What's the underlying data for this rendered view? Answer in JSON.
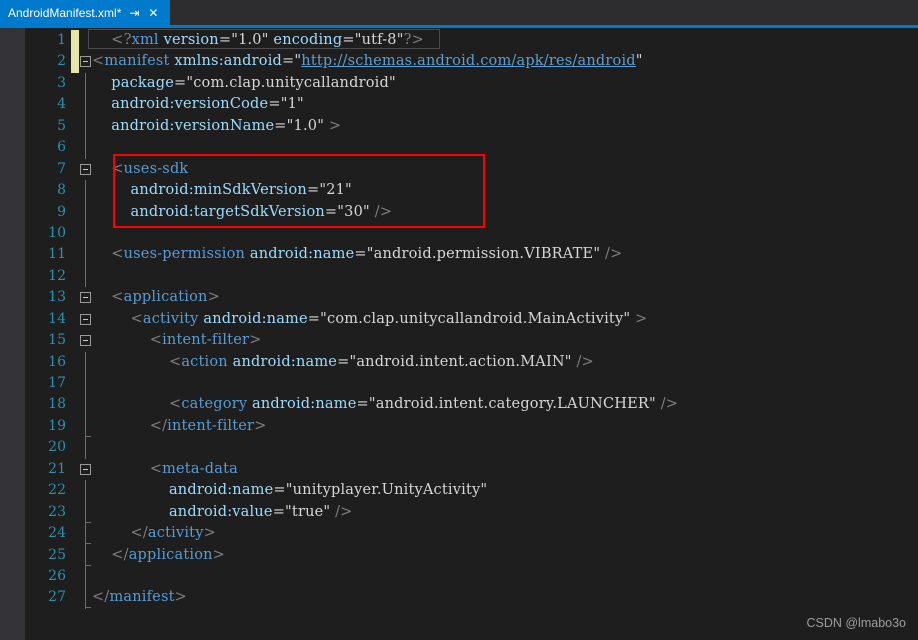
{
  "tab": {
    "title": "AndroidManifest.xml*",
    "pin_icon": "pin-icon",
    "close_icon": "close-icon",
    "pin_glyph": "⇥",
    "close_glyph": "✕"
  },
  "editor": {
    "language": "xml",
    "accent_color": "#007acc",
    "background": "#1e1e1e",
    "gutter_color": "#2b91af",
    "annotation_color": "#ff0000",
    "total_lines": 27,
    "lines": [
      {
        "n": 1,
        "changed": true,
        "fold": "none",
        "text": "    <?xml version=\"1.0\" encoding=\"utf-8\"?>"
      },
      {
        "n": 2,
        "changed": true,
        "fold": "open",
        "text": "<manifest xmlns:android=\"http://schemas.android.com/apk/res/android\""
      },
      {
        "n": 3,
        "changed": false,
        "fold": "line",
        "text": "    package=\"com.clap.unitycallandroid\""
      },
      {
        "n": 4,
        "changed": false,
        "fold": "line",
        "text": "    android:versionCode=\"1\""
      },
      {
        "n": 5,
        "changed": false,
        "fold": "line",
        "text": "    android:versionName=\"1.0\" >"
      },
      {
        "n": 6,
        "changed": false,
        "fold": "line",
        "text": ""
      },
      {
        "n": 7,
        "changed": false,
        "fold": "open",
        "text": "    <uses-sdk"
      },
      {
        "n": 8,
        "changed": false,
        "fold": "line",
        "text": "        android:minSdkVersion=\"21\""
      },
      {
        "n": 9,
        "changed": false,
        "fold": "line",
        "text": "        android:targetSdkVersion=\"30\" />"
      },
      {
        "n": 10,
        "changed": false,
        "fold": "line",
        "text": ""
      },
      {
        "n": 11,
        "changed": false,
        "fold": "line",
        "text": "    <uses-permission android:name=\"android.permission.VIBRATE\" />"
      },
      {
        "n": 12,
        "changed": false,
        "fold": "line",
        "text": ""
      },
      {
        "n": 13,
        "changed": false,
        "fold": "open",
        "text": "    <application>"
      },
      {
        "n": 14,
        "changed": false,
        "fold": "open",
        "text": "        <activity android:name=\"com.clap.unitycallandroid.MainActivity\" >"
      },
      {
        "n": 15,
        "changed": false,
        "fold": "open",
        "text": "            <intent-filter>"
      },
      {
        "n": 16,
        "changed": false,
        "fold": "line",
        "text": "                <action android:name=\"android.intent.action.MAIN\" />"
      },
      {
        "n": 17,
        "changed": false,
        "fold": "line",
        "text": ""
      },
      {
        "n": 18,
        "changed": false,
        "fold": "line",
        "text": "                <category android:name=\"android.intent.category.LAUNCHER\" />"
      },
      {
        "n": 19,
        "changed": false,
        "fold": "end",
        "text": "            </intent-filter>"
      },
      {
        "n": 20,
        "changed": false,
        "fold": "line",
        "text": ""
      },
      {
        "n": 21,
        "changed": false,
        "fold": "open",
        "text": "            <meta-data"
      },
      {
        "n": 22,
        "changed": false,
        "fold": "line",
        "text": "                android:name=\"unityplayer.UnityActivity\""
      },
      {
        "n": 23,
        "changed": false,
        "fold": "end",
        "text": "                android:value=\"true\" />"
      },
      {
        "n": 24,
        "changed": false,
        "fold": "end",
        "text": "        </activity>"
      },
      {
        "n": 25,
        "changed": false,
        "fold": "end",
        "text": "    </application>"
      },
      {
        "n": 26,
        "changed": false,
        "fold": "line",
        "text": ""
      },
      {
        "n": 27,
        "changed": false,
        "fold": "end",
        "text": "</manifest>"
      }
    ]
  },
  "annotation": {
    "type": "red-rectangle",
    "covers_lines": [
      7,
      8,
      9
    ],
    "color": "#ff0000"
  },
  "watermark": {
    "text": "CSDN @lmabo3o"
  }
}
